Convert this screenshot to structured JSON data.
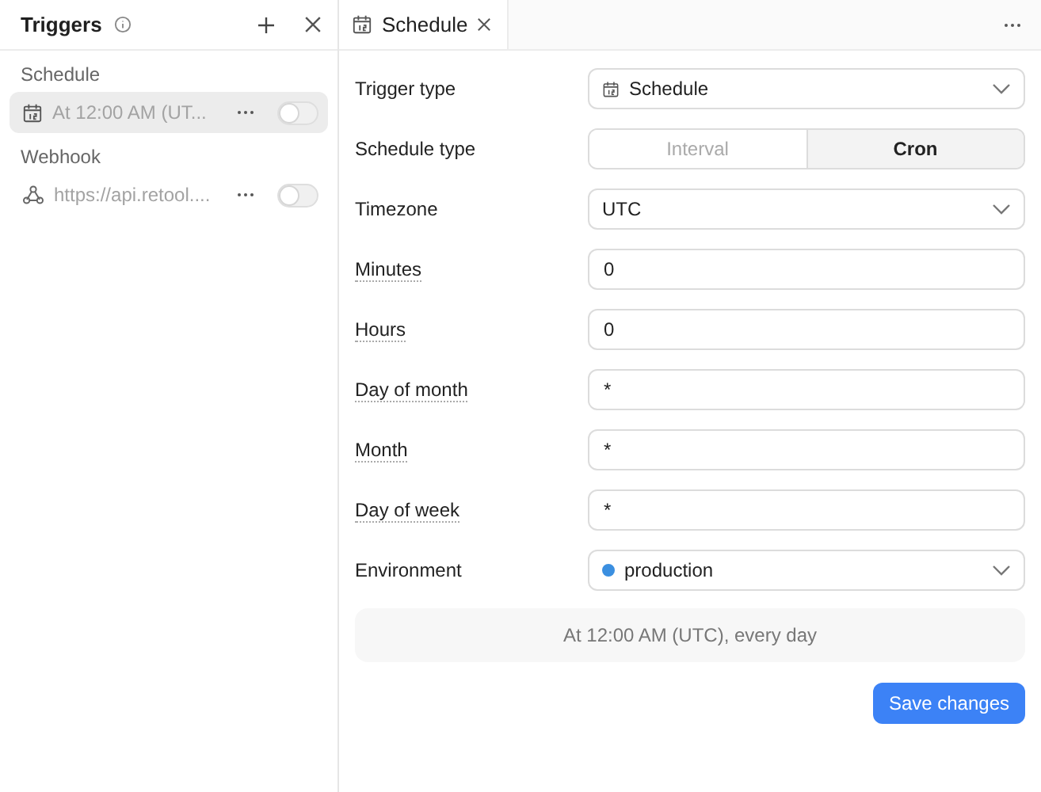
{
  "sidebar": {
    "title": "Triggers",
    "groups": [
      {
        "label": "Schedule",
        "items": [
          {
            "kind": "schedule",
            "text": "At 12:00 AM (UT...",
            "selected": true,
            "on": false
          }
        ]
      },
      {
        "label": "Webhook",
        "items": [
          {
            "kind": "webhook",
            "text": "https://api.retool....",
            "selected": false,
            "on": false
          }
        ]
      }
    ]
  },
  "tab": {
    "label": "Schedule"
  },
  "form": [
    {
      "label": "Trigger type",
      "kind": "type_select",
      "value": "Schedule",
      "hint": false
    },
    {
      "label": "Schedule type",
      "kind": "segmented",
      "hint": false,
      "options": [
        {
          "label": "Interval",
          "selected": false
        },
        {
          "label": "Cron",
          "selected": true
        }
      ]
    },
    {
      "label": "Timezone",
      "kind": "select",
      "value": "UTC",
      "hint": false
    },
    {
      "label": "Minutes",
      "kind": "input",
      "value": "0",
      "hint": true
    },
    {
      "label": "Hours",
      "kind": "input",
      "value": "0",
      "hint": true
    },
    {
      "label": "Day of month",
      "kind": "input",
      "value": "*",
      "hint": true
    },
    {
      "label": "Month",
      "kind": "input",
      "value": "*",
      "hint": true
    },
    {
      "label": "Day of week",
      "kind": "input",
      "value": "*",
      "hint": true
    },
    {
      "label": "Environment",
      "kind": "select",
      "value": "production",
      "color": "#3b8fe0",
      "hint": false
    }
  ],
  "summary": "At 12:00 AM (UTC), every day",
  "save_button": "Save changes"
}
